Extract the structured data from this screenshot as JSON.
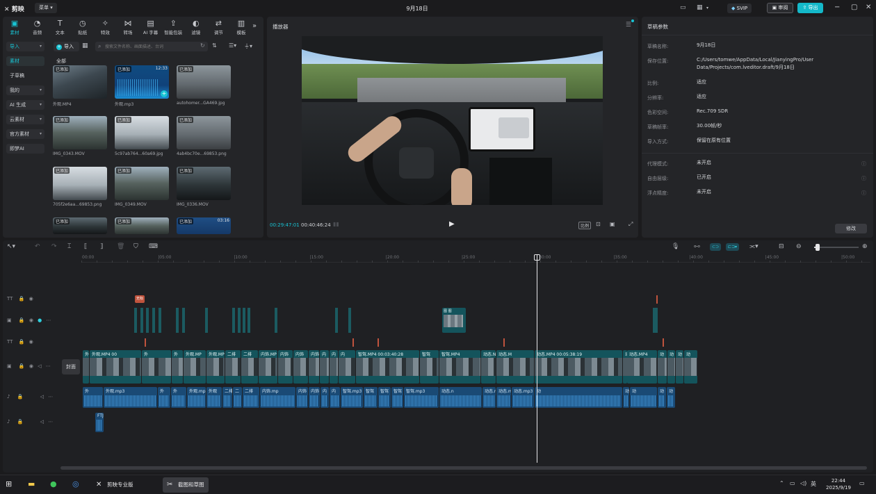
{
  "titlebar": {
    "app_name": "剪映",
    "menu_label": "菜单",
    "window_title": "9月18日",
    "svip": "SVIP",
    "review": "审阅",
    "export": "导出"
  },
  "tool_tabs": [
    {
      "label": "素材",
      "icon": "media-icon"
    },
    {
      "label": "音频",
      "icon": "audio-icon"
    },
    {
      "label": "文本",
      "icon": "text-icon"
    },
    {
      "label": "贴纸",
      "icon": "sticker-icon"
    },
    {
      "label": "特效",
      "icon": "effects-icon"
    },
    {
      "label": "转场",
      "icon": "transition-icon"
    },
    {
      "label": "AI 字幕",
      "icon": "ai-caption-icon"
    },
    {
      "label": "智能包装",
      "icon": "smart-pack-icon"
    },
    {
      "label": "滤镜",
      "icon": "filter-icon"
    },
    {
      "label": "调节",
      "icon": "adjust-icon"
    },
    {
      "label": "模板",
      "icon": "template-icon"
    }
  ],
  "media_sidebar": [
    {
      "label": "导入",
      "chevron": true
    },
    {
      "label": "素材",
      "chevron": false
    },
    {
      "label": "子草稿",
      "chevron": false
    },
    {
      "label": "我的",
      "chevron": true
    },
    {
      "label": "AI 生成",
      "chevron": true
    },
    {
      "label": "云素材",
      "chevron": true
    },
    {
      "label": "官方素材",
      "chevron": true
    },
    {
      "label": "即梦AI",
      "chevron": false
    }
  ],
  "media_toolbar": {
    "import_label": "导入",
    "search_placeholder": "搜索文件名称、画面描述、台词",
    "all_label": "全部"
  },
  "media_items": [
    {
      "badge": "已添加",
      "duration": "",
      "name": "外观.MP4"
    },
    {
      "badge": "已添加",
      "duration": "12:33",
      "name": "外观.mp3"
    },
    {
      "badge": "已添加",
      "duration": "",
      "name": "autohomer...GA469.jpg"
    },
    {
      "badge": "已添加",
      "duration": "",
      "name": "IMG_0343.MOV"
    },
    {
      "badge": "已添加",
      "duration": "",
      "name": "5c97ab764...60a69.jpg"
    },
    {
      "badge": "已添加",
      "duration": "",
      "name": "4ab4bc70e...69853.png"
    },
    {
      "badge": "已添加",
      "duration": "",
      "name": "705f2e6aa...69853.png"
    },
    {
      "badge": "已添加",
      "duration": "",
      "name": "IMG_0349.MOV"
    },
    {
      "badge": "已添加",
      "duration": "",
      "name": "IMG_0336.MOV"
    },
    {
      "badge": "已添加",
      "duration": "",
      "name": ""
    },
    {
      "badge": "已添加",
      "duration": "",
      "name": ""
    },
    {
      "badge": "已添加",
      "duration": "03:16",
      "name": ""
    }
  ],
  "player": {
    "title": "播放器",
    "current_time": "00:29:47:01",
    "total_time": "00:40:46:24",
    "ratio_label": "比例"
  },
  "properties": {
    "title": "草稿参数",
    "rows": [
      {
        "label": "草稿名称:",
        "value": "9月18日"
      },
      {
        "label": "保存位置:",
        "value": "C:/Users/tomwe/AppData/Local/JianyingPro/User Data/Projects/com.lveditor.draft/9月18日"
      },
      {
        "label": "比例:",
        "value": "适应"
      },
      {
        "label": "分辨率:",
        "value": "适应"
      },
      {
        "label": "色彩空间:",
        "value": "Rec.709 SDR"
      },
      {
        "label": "草稿帧率:",
        "value": "30.00帧/秒"
      },
      {
        "label": "导入方式:",
        "value": "保留在原有位置"
      }
    ],
    "rows2": [
      {
        "label": "代理模式:",
        "value": "未开启"
      },
      {
        "label": "自由层级:",
        "value": "已开启"
      },
      {
        "label": "浮点精度:",
        "value": "未开启"
      }
    ],
    "modify_button": "修改"
  },
  "timeline": {
    "ruler": [
      "00:00",
      "|05:00",
      "|10:00",
      "|15:00",
      "|20:00",
      "|25:00",
      "|30:00",
      "|35:00",
      "|40:00",
      "|45:00",
      "|50:00"
    ],
    "cover_label": "封面",
    "title_marker": "无标",
    "image_clip_label": "图 图",
    "video_clips": [
      {
        "label": "外"
      },
      {
        "label": "外观.MP4 00"
      },
      {
        "label": "外"
      },
      {
        "label": "外"
      },
      {
        "label": "外观.MP"
      },
      {
        "label": "外观.MP"
      },
      {
        "label": "二排"
      },
      {
        "label": "二排"
      },
      {
        "label": "内饰.MP"
      },
      {
        "label": "内饰"
      },
      {
        "label": "内饰"
      },
      {
        "label": "内饰"
      },
      {
        "label": "内"
      },
      {
        "label": "内"
      },
      {
        "label": "内"
      },
      {
        "label": "智驾.MP4 00:03:40:28"
      },
      {
        "label": "智驾"
      },
      {
        "label": "智驾.MP4"
      },
      {
        "label": "动态.N"
      },
      {
        "label": "动态.M"
      },
      {
        "label": "动态.MP4 00:05:38:19"
      },
      {
        "label": "动"
      },
      {
        "label": "动态.MP4"
      },
      {
        "label": "动"
      },
      {
        "label": "动"
      },
      {
        "label": "动"
      },
      {
        "label": "动"
      }
    ],
    "audio_clips": [
      {
        "label": "外"
      },
      {
        "label": "外观.mp3"
      },
      {
        "label": "外"
      },
      {
        "label": "外"
      },
      {
        "label": "外观.mp3"
      },
      {
        "label": "外观"
      },
      {
        "label": "二排"
      },
      {
        "label": "二"
      },
      {
        "label": "二排"
      },
      {
        "label": "内饰.mp"
      },
      {
        "label": "内饰"
      },
      {
        "label": "内饰"
      },
      {
        "label": "内"
      },
      {
        "label": "内"
      },
      {
        "label": "智驾.mp3"
      },
      {
        "label": "智驾"
      },
      {
        "label": "智驾"
      },
      {
        "label": "智驾"
      },
      {
        "label": "智驾.mp3"
      },
      {
        "label": "动态.n"
      },
      {
        "label": "动态.mp3"
      },
      {
        "label": "动态.mp3"
      },
      {
        "label": "动态.mp3"
      },
      {
        "label": "动"
      },
      {
        "label": "动态.mp3"
      },
      {
        "label": "动"
      },
      {
        "label": "动"
      },
      {
        "label": "动"
      }
    ],
    "extra_audio_label": "FTJ"
  },
  "taskbar": {
    "tasks": [
      {
        "label": "剪映专业版",
        "icon": "capcut-icon"
      },
      {
        "label": "截图和草图",
        "icon": "snip-icon"
      }
    ],
    "ime": "英",
    "time": "22:44",
    "date": "2025/9/19"
  }
}
